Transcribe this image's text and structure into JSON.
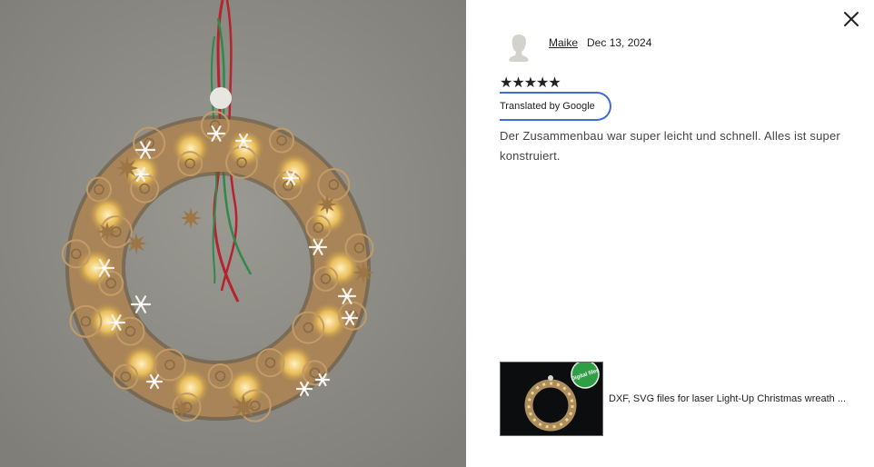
{
  "review": {
    "reviewer_name": "Maike",
    "date": "Dec 13, 2024",
    "rating": 5,
    "stars_text": "★★★★★",
    "translate_label": "Translated by Google",
    "text": "Der Zusammenbau war super leicht und schnell. Alles ist super konstruiert."
  },
  "product": {
    "title": "DXF, SVG files for laser Light-Up Christmas wreath ...",
    "badge_text": "Digital files"
  },
  "icons": {
    "close": "close-icon",
    "avatar": "user-avatar-icon"
  },
  "colors": {
    "accent_border": "#3e6bd5",
    "photo_wall": "#8d8c86",
    "wood": "#a88458",
    "glow": "#f4c666",
    "badge": "#2f9e45",
    "ribbon_red": "#b5232e",
    "ribbon_green": "#2f8a4a"
  }
}
